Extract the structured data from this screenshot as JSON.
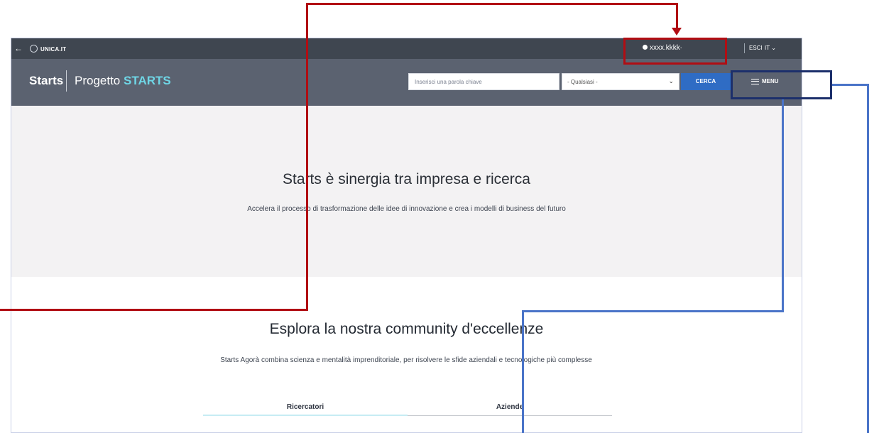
{
  "topbar": {
    "back_icon": "arrow-left-icon",
    "org": "UNICA.IT",
    "user": "xxxx.kkkk∙",
    "exit": "ESCI",
    "language": "IT ⌄"
  },
  "header": {
    "brand": "Starts",
    "project_prefix": "Progetto",
    "project_name": "STARTS",
    "search_placeholder": "Inserisci una parola chiave",
    "select_value": "- Qualsiasi -",
    "search_button": "CERCA",
    "menu_label": "MENU"
  },
  "hero": {
    "title": "Starts è sinergia tra impresa e ricerca",
    "subtitle": "Accelera il processo di trasformazione delle idee di innovazione e crea i modelli di business del futuro"
  },
  "community": {
    "title": "Esplora la nostra community d'eccellenze",
    "description": "Starts Agorà combina scienza e mentalità imprenditoriale, per risolvere le sfide aziendali e tecnologiche più complesse",
    "tabs": [
      "Ricercatori",
      "Aziende"
    ]
  },
  "colors": {
    "accent": "#6fd6e6",
    "button": "#2f6cc4",
    "annotation_red": "#b10d13",
    "annotation_blue": "#4a74c8",
    "annotation_navy": "#1c2f6b"
  }
}
